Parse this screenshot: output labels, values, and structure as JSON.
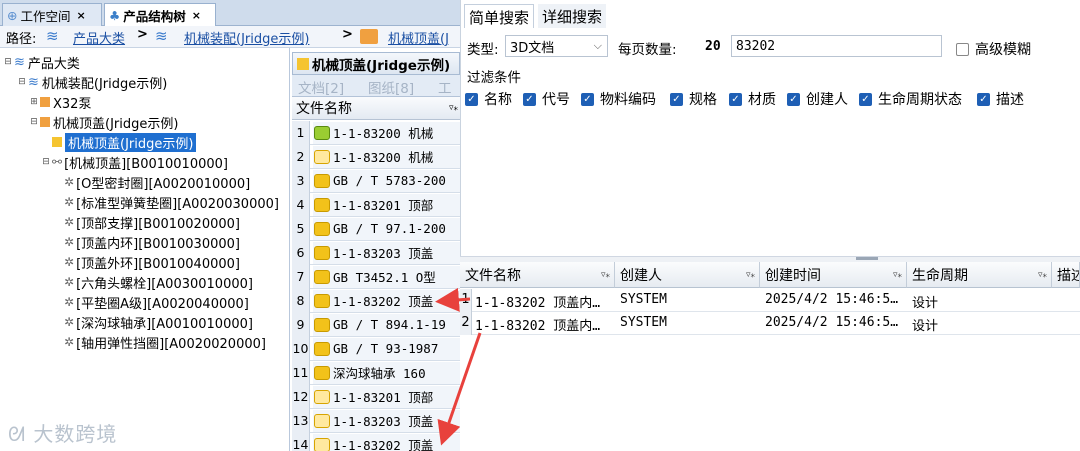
{
  "tabs": [
    {
      "label": "工作空间"
    },
    {
      "label": "产品结构树"
    }
  ],
  "path": {
    "label": "路径:",
    "crumbs": [
      "产品大类",
      "机械装配(Jridge示例)",
      "机械顶盖(J"
    ]
  },
  "tree": [
    {
      "label": "产品大类"
    },
    {
      "label": "机械装配(Jridge示例)"
    },
    {
      "label": "X32泵"
    },
    {
      "label": "机械顶盖(Jridge示例)"
    },
    {
      "label": "机械顶盖(Jridge示例)"
    },
    {
      "label": "[机械顶盖][B0010010000]"
    },
    {
      "label": "[O型密封圈][A0020010000]"
    },
    {
      "label": "[标准型弹簧垫圈][A0020030000]"
    },
    {
      "label": "[顶部支撑][B0010020000]"
    },
    {
      "label": "[顶盖内环][B0010030000]"
    },
    {
      "label": "[顶盖外环][B0010040000]"
    },
    {
      "label": "[六角头螺栓][A0030010000]"
    },
    {
      "label": "[平垫圈A级][A0020040000]"
    },
    {
      "label": "[深沟球轴承][A0010010000]"
    },
    {
      "label": "[轴用弹性挡圈][A0020020000]"
    }
  ],
  "middle": {
    "title": "机械顶盖(Jridge示例)",
    "tabs": [
      "文档[2]",
      "图纸[8]",
      "工"
    ],
    "column": "文件名称",
    "rows": [
      {
        "n": "1",
        "text": "1-1-83200 机械"
      },
      {
        "n": "2",
        "text": "1-1-83200 机械"
      },
      {
        "n": "3",
        "text": "GB / T 5783-200"
      },
      {
        "n": "4",
        "text": "1-1-83201 顶部"
      },
      {
        "n": "5",
        "text": "GB / T 97.1-200"
      },
      {
        "n": "6",
        "text": "1-1-83203 顶盖"
      },
      {
        "n": "7",
        "text": "GB T3452.1 O型"
      },
      {
        "n": "8",
        "text": "1-1-83202 顶盖"
      },
      {
        "n": "9",
        "text": "GB / T 894.1-19"
      },
      {
        "n": "10",
        "text": "GB / T 93-1987"
      },
      {
        "n": "11",
        "text": "深沟球轴承 160"
      },
      {
        "n": "12",
        "text": "1-1-83201 顶部"
      },
      {
        "n": "13",
        "text": "1-1-83203 顶盖"
      },
      {
        "n": "14",
        "text": "1-1-83202 顶盖"
      }
    ]
  },
  "search": {
    "tab_simple": "简单搜索",
    "tab_detail": "详细搜索",
    "type_label": "类型:",
    "type_value": "3D文档",
    "page_label": "每页数量:",
    "page_value": "20",
    "keyword": "83202",
    "fuzzy": "高级模糊",
    "filter_title": "过滤条件",
    "filters": [
      "名称",
      "代号",
      "物料编码",
      "规格",
      "材质",
      "创建人",
      "生命周期状态",
      "描述"
    ]
  },
  "results": {
    "columns": [
      "文件名称",
      "创建人",
      "创建时间",
      "生命周期",
      "描述"
    ],
    "rows": [
      {
        "n": "1",
        "name": "1-1-83202 顶盖内…",
        "creator": "SYSTEM",
        "time": "2025/4/2 15:46:5…",
        "state": "设计"
      },
      {
        "n": "2",
        "name": "1-1-83202 顶盖内…",
        "creator": "SYSTEM",
        "time": "2025/4/2 15:46:5…",
        "state": "设计"
      }
    ]
  },
  "watermark": "大数跨境",
  "colors": {
    "selection": "#1f6fd0",
    "checkbox": "#1e5fb5",
    "arrow": "#e8413c"
  }
}
